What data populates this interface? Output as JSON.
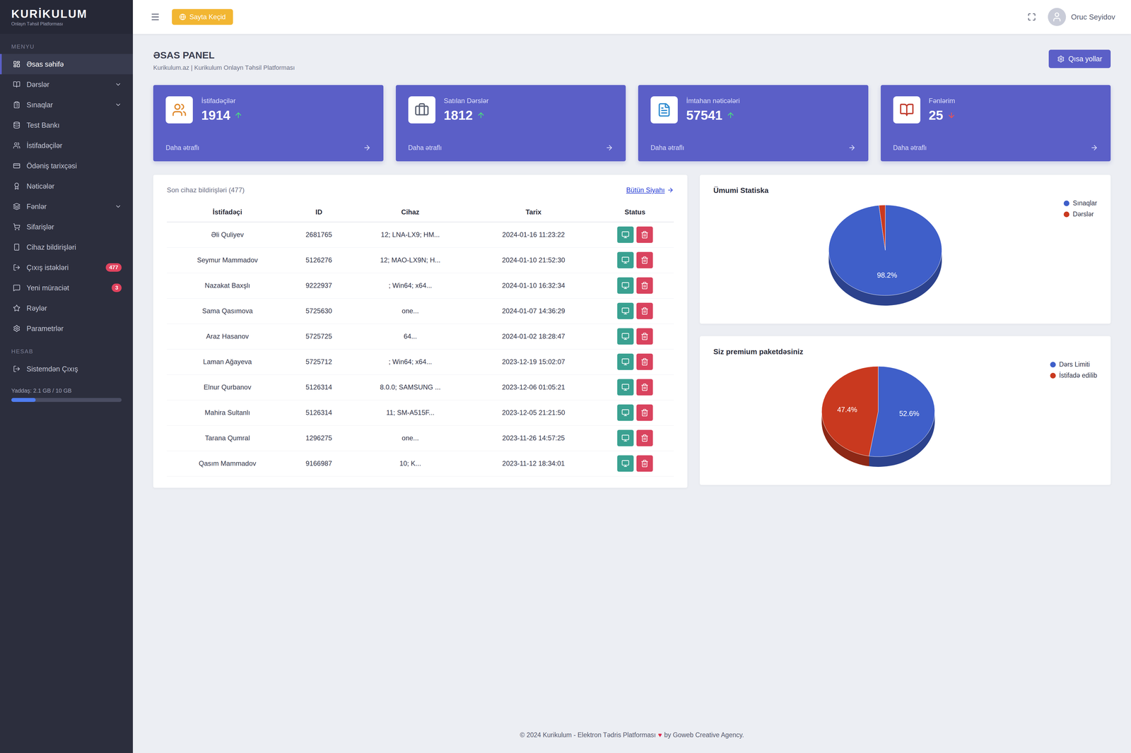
{
  "sidebar": {
    "logo": "KURİKULUM",
    "logo_tagline": "Onlayn Təhsil Platforması",
    "section": "MENYU",
    "items": [
      {
        "label": "Əsas səhifə",
        "selected": true,
        "expandable": false
      },
      {
        "label": "Dərslər",
        "selected": false,
        "expandable": true
      },
      {
        "label": "Sınaqlar",
        "selected": false,
        "expandable": true
      },
      {
        "label": "Test Bankı",
        "selected": false,
        "expandable": false
      },
      {
        "label": "İstifadəçilər",
        "selected": false,
        "expandable": false
      },
      {
        "label": "Ödəniş tarixçəsi",
        "selected": false,
        "expandable": false
      },
      {
        "label": "Nəticələr",
        "selected": false,
        "expandable": false
      },
      {
        "label": "Fənlər",
        "selected": false,
        "expandable": true
      },
      {
        "label": "Sifarişlər",
        "selected": false,
        "expandable": false
      },
      {
        "label": "Cihaz bildirişləri",
        "selected": false,
        "expandable": false
      },
      {
        "label": "Çıxış istəkləri",
        "selected": false,
        "expandable": false,
        "badge": "477"
      },
      {
        "label": "Yeni müraciət",
        "selected": false,
        "expandable": false,
        "badge": "3"
      },
      {
        "label": "Rəylər",
        "selected": false,
        "expandable": false
      },
      {
        "label": "Parametrlər",
        "selected": false,
        "expandable": false
      }
    ],
    "section2": "HESAB",
    "bottom_item": "Sistemdən Çıxış",
    "storage": {
      "label": "Yaddaş: 2.1 GB / 10 GB",
      "level": 0.22
    }
  },
  "topbar": {
    "site_button": "Sayta Keçid",
    "user": "Oruc Seyidov"
  },
  "header": {
    "title": "ƏSAS PANEL",
    "subtitle": "Kurikulum.az | Kurikulum Onlayn Təhsil Platforması",
    "shortcuts_button": "Qısa yollar"
  },
  "stats": [
    {
      "label": "İstifadəçilər",
      "value": "1914",
      "trend": "up",
      "link": "Daha ətraflı"
    },
    {
      "label": "Satılan Dərslər",
      "value": "1812",
      "trend": "up",
      "link": "Daha ətraflı"
    },
    {
      "label": "İmtahan nəticələri",
      "value": "57541",
      "trend": "up",
      "link": "Daha ətraflı"
    },
    {
      "label": "Fənlərim",
      "value": "25",
      "trend": "down",
      "link": "Daha ətraflı"
    }
  ],
  "table": {
    "title": "Son cihaz bildirişləri (477)",
    "link": "Bütün Siyahı",
    "columns": [
      "İstifadəçi",
      "ID",
      "Cihaz",
      "Tarix",
      "Status"
    ],
    "rows": [
      {
        "user": "Əli Quliyev",
        "id": "2681765",
        "device": "12; LNA-LX9; HM...",
        "date": "2024-01-16 11:23:22"
      },
      {
        "user": "Seymur Mammadov",
        "id": "5126276",
        "device": "12; MAO-LX9N; H...",
        "date": "2024-01-10 21:52:30"
      },
      {
        "user": "Nazakat Baxşlı",
        "id": "9222937",
        "device": "; Win64; x64...",
        "date": "2024-01-10 16:32:34"
      },
      {
        "user": "Sama Qasımova",
        "id": "5725630",
        "device": "one...",
        "date": "2024-01-07 14:36:29"
      },
      {
        "user": "Araz Hasanov",
        "id": "5725725",
        "device": "64...",
        "date": "2024-01-02 18:28:47"
      },
      {
        "user": "Laman Ağayeva",
        "id": "5725712",
        "device": "; Win64; x64...",
        "date": "2023-12-19 15:02:07"
      },
      {
        "user": "Elnur Qurbanov",
        "id": "5126314",
        "device": "8.0.0; SAMSUNG ...",
        "date": "2023-12-06 01:05:21"
      },
      {
        "user": "Mahira Sultanlı",
        "id": "5126314",
        "device": "11; SM-A515F...",
        "date": "2023-12-05 21:21:50"
      },
      {
        "user": "Tarana Qumral",
        "id": "1296275",
        "device": "one...",
        "date": "2023-11-26 14:57:25"
      },
      {
        "user": "Qasım Mammadov",
        "id": "9166987",
        "device": "10; K...",
        "date": "2023-11-12 18:34:01"
      }
    ]
  },
  "charts": [
    {
      "title": "Ümumi Statiska",
      "series": [
        {
          "name": "Sınaqlar",
          "value": 98.2,
          "label": "98.2%",
          "color": "#3f5fc9"
        },
        {
          "name": "Dərslər",
          "value": 1.8,
          "color": "#c9391f"
        }
      ]
    },
    {
      "title": "Siz premium paketdəsiniz",
      "series": [
        {
          "name": "Dərs Limiti",
          "value": 52.6,
          "label": "52.6%",
          "color": "#3f5fc9"
        },
        {
          "name": "İstifadə edilib",
          "value": 47.4,
          "label": "47.4%",
          "color": "#c9391f"
        }
      ]
    }
  ],
  "footer": {
    "text": "© 2024 Kurikulum - Elektron Tədris Platforması",
    "heart": "♥",
    "credit": "by Goweb Creative Agency."
  }
}
